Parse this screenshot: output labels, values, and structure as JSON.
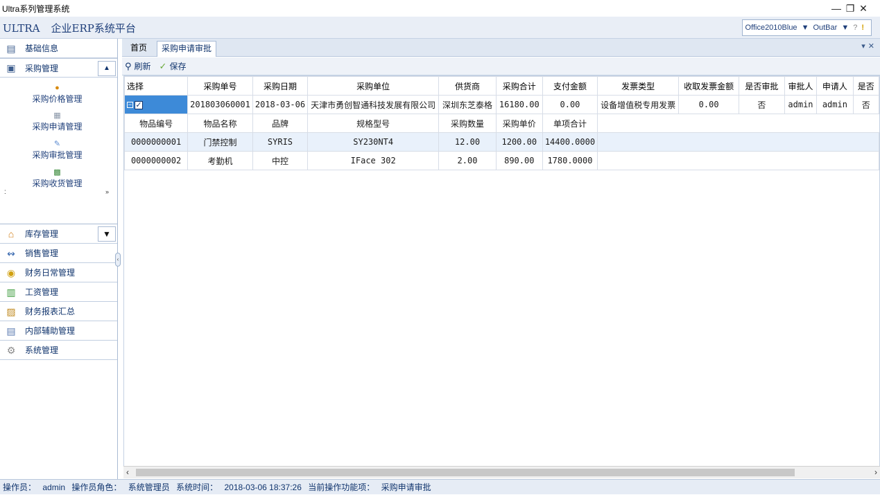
{
  "window": {
    "title": "Ultra系列管理系统"
  },
  "appbar": {
    "brand": "ULTRA",
    "brand_sub": "企业ERP系统平台",
    "theme": "Office2010Blue",
    "nav_style": "OutBar"
  },
  "sidebar": {
    "top_item": "基础信息",
    "expanded_group": "采购管理",
    "sub_items": [
      "采购价格管理",
      "采购申请管理",
      "采购审批管理",
      "采购收货管理"
    ],
    "groups": [
      "库存管理",
      "销售管理",
      "财务日常管理",
      "工资管理",
      "财务报表汇总",
      "内部辅助管理",
      "系统管理"
    ]
  },
  "tabs": [
    "首页",
    "采购申请审批"
  ],
  "toolbar": {
    "refresh": "刷新",
    "save": "保存"
  },
  "grid": {
    "headers": [
      "选择",
      "采购单号",
      "采购日期",
      "采购单位",
      "供货商",
      "采购合计",
      "支付金额",
      "发票类型",
      "收取发票金额",
      "是否审批",
      "审批人",
      "申请人",
      "是否"
    ],
    "master": [
      "",
      "201803060001",
      "2018-03-06",
      "天津市勇创智通科技发展有限公司",
      "深圳东芝泰格",
      "16180.00",
      "0.00",
      "设备增值税专用发票",
      "0.00",
      "否",
      "admin",
      "admin",
      "否"
    ],
    "detail_headers": [
      "物品编号",
      "物品名称",
      "品牌",
      "规格型号",
      "采购数量",
      "采购单价",
      "单项合计"
    ],
    "detail_rows": [
      [
        "0000000001",
        "门禁控制",
        "SYRIS",
        "SY230NT4",
        "12.00",
        "1200.00",
        "14400.0000"
      ],
      [
        "0000000002",
        "考勤机",
        "中控",
        "IFace 302",
        "2.00",
        "890.00",
        "1780.0000"
      ]
    ]
  },
  "status": {
    "operator_label": "操作员：",
    "operator": "admin",
    "role_label": "操作员角色：",
    "role": "系统管理员",
    "time_label": "系统时间：",
    "time": "2018-03-06 18:37:26",
    "func_label": "当前操作功能项：",
    "func": "采购申请审批"
  }
}
